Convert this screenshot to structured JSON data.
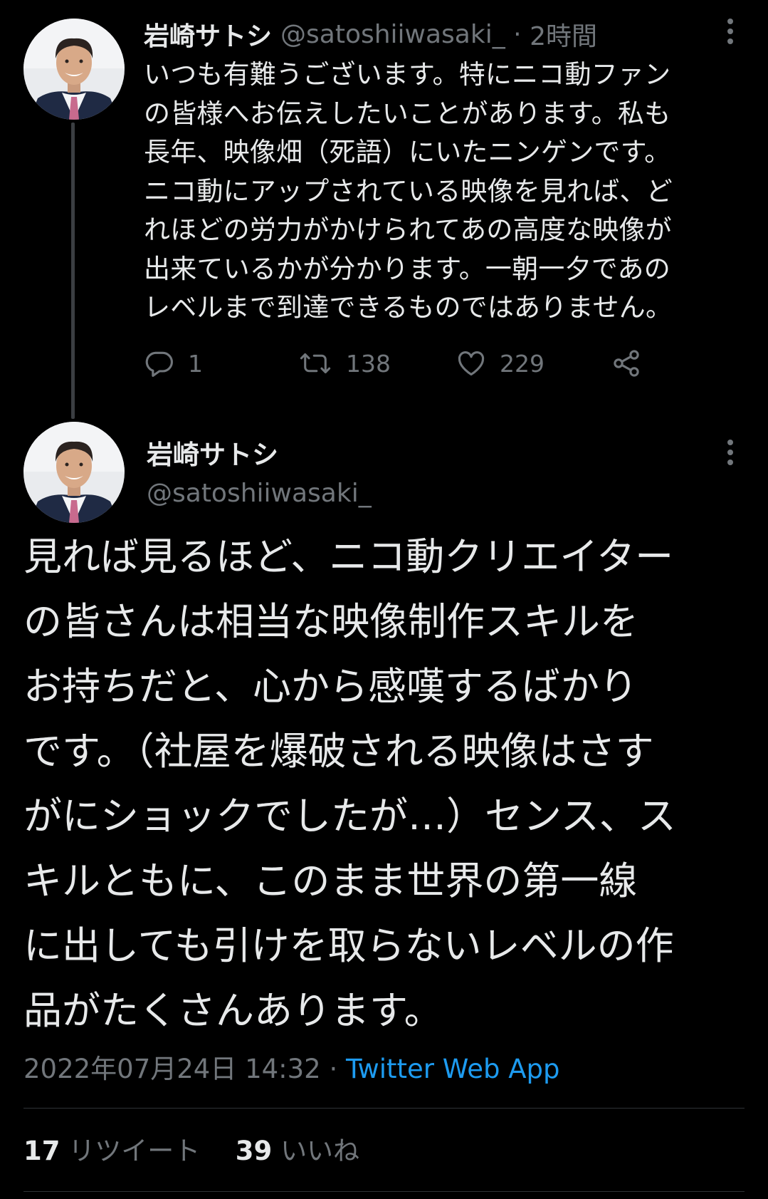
{
  "parent_tweet": {
    "display_name": "岩崎サトシ",
    "handle": "@satoshiiwasaki_",
    "separator": " · ",
    "time": "2時間",
    "text_lines": [
      "いつも有難うございます。特にニコ動ファン",
      "の皆様へお伝えしたいことがあります。私も",
      "長年、映像畑（死語）にいたニンゲンです。",
      "ニコ動にアップされている映像を見れば、ど",
      "れほどの労力がかけられてあの高度な映像が",
      "出来ているかが分かります。一朝一夕であの",
      "レベルまで到達できるものではありません。"
    ],
    "actions": {
      "reply_count": "1",
      "retweet_count": "138",
      "like_count": "229"
    }
  },
  "main_tweet": {
    "display_name": "岩崎サトシ",
    "handle": "@satoshiiwasaki_",
    "text_lines": [
      "見れば見るほど、ニコ動クリエイター",
      "の皆さんは相当な映像制作スキルを",
      "お持ちだと、心から感嘆するばかり",
      "です。（社屋を爆破される映像はさす",
      "がにショックでしたが…）センス、ス",
      "キルともに、このまま世界の第一線",
      "に出しても引けを取らないレベルの作",
      "品がたくさんあります。"
    ],
    "timestamp": "2022年07月24日 14:32",
    "separator": " · ",
    "source": "Twitter Web App",
    "retweet_count": "17",
    "retweet_label": "リツイート",
    "like_count": "39",
    "like_label": "いいね"
  },
  "colors": {
    "background": "#000000",
    "text_primary": "#e7e9ea",
    "text_secondary": "#71767b",
    "link": "#1d9bf0",
    "divider": "#2f3336"
  },
  "icons": [
    "more-options-icon",
    "reply-icon",
    "retweet-icon",
    "like-icon",
    "share-icon",
    "avatar"
  ]
}
